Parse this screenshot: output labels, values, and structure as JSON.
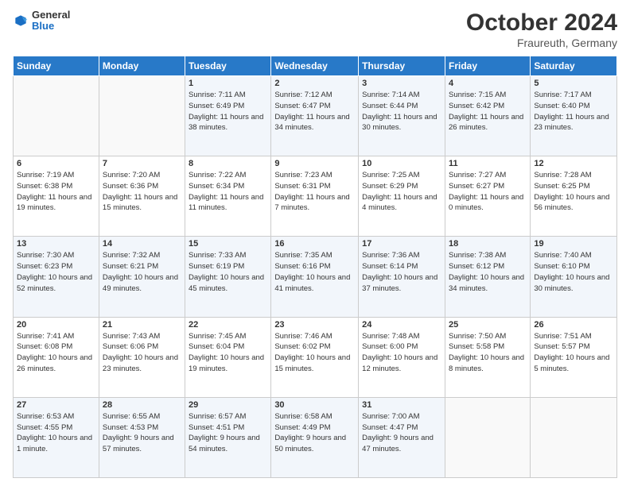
{
  "header": {
    "logo": {
      "line1": "General",
      "line2": "Blue"
    },
    "title": "October 2024",
    "subtitle": "Fraureuth, Germany"
  },
  "calendar": {
    "weekdays": [
      "Sunday",
      "Monday",
      "Tuesday",
      "Wednesday",
      "Thursday",
      "Friday",
      "Saturday"
    ],
    "weeks": [
      [
        {
          "day": "",
          "sunrise": "",
          "sunset": "",
          "daylight": ""
        },
        {
          "day": "",
          "sunrise": "",
          "sunset": "",
          "daylight": ""
        },
        {
          "day": "1",
          "sunrise": "Sunrise: 7:11 AM",
          "sunset": "Sunset: 6:49 PM",
          "daylight": "Daylight: 11 hours and 38 minutes."
        },
        {
          "day": "2",
          "sunrise": "Sunrise: 7:12 AM",
          "sunset": "Sunset: 6:47 PM",
          "daylight": "Daylight: 11 hours and 34 minutes."
        },
        {
          "day": "3",
          "sunrise": "Sunrise: 7:14 AM",
          "sunset": "Sunset: 6:44 PM",
          "daylight": "Daylight: 11 hours and 30 minutes."
        },
        {
          "day": "4",
          "sunrise": "Sunrise: 7:15 AM",
          "sunset": "Sunset: 6:42 PM",
          "daylight": "Daylight: 11 hours and 26 minutes."
        },
        {
          "day": "5",
          "sunrise": "Sunrise: 7:17 AM",
          "sunset": "Sunset: 6:40 PM",
          "daylight": "Daylight: 11 hours and 23 minutes."
        }
      ],
      [
        {
          "day": "6",
          "sunrise": "Sunrise: 7:19 AM",
          "sunset": "Sunset: 6:38 PM",
          "daylight": "Daylight: 11 hours and 19 minutes."
        },
        {
          "day": "7",
          "sunrise": "Sunrise: 7:20 AM",
          "sunset": "Sunset: 6:36 PM",
          "daylight": "Daylight: 11 hours and 15 minutes."
        },
        {
          "day": "8",
          "sunrise": "Sunrise: 7:22 AM",
          "sunset": "Sunset: 6:34 PM",
          "daylight": "Daylight: 11 hours and 11 minutes."
        },
        {
          "day": "9",
          "sunrise": "Sunrise: 7:23 AM",
          "sunset": "Sunset: 6:31 PM",
          "daylight": "Daylight: 11 hours and 7 minutes."
        },
        {
          "day": "10",
          "sunrise": "Sunrise: 7:25 AM",
          "sunset": "Sunset: 6:29 PM",
          "daylight": "Daylight: 11 hours and 4 minutes."
        },
        {
          "day": "11",
          "sunrise": "Sunrise: 7:27 AM",
          "sunset": "Sunset: 6:27 PM",
          "daylight": "Daylight: 11 hours and 0 minutes."
        },
        {
          "day": "12",
          "sunrise": "Sunrise: 7:28 AM",
          "sunset": "Sunset: 6:25 PM",
          "daylight": "Daylight: 10 hours and 56 minutes."
        }
      ],
      [
        {
          "day": "13",
          "sunrise": "Sunrise: 7:30 AM",
          "sunset": "Sunset: 6:23 PM",
          "daylight": "Daylight: 10 hours and 52 minutes."
        },
        {
          "day": "14",
          "sunrise": "Sunrise: 7:32 AM",
          "sunset": "Sunset: 6:21 PM",
          "daylight": "Daylight: 10 hours and 49 minutes."
        },
        {
          "day": "15",
          "sunrise": "Sunrise: 7:33 AM",
          "sunset": "Sunset: 6:19 PM",
          "daylight": "Daylight: 10 hours and 45 minutes."
        },
        {
          "day": "16",
          "sunrise": "Sunrise: 7:35 AM",
          "sunset": "Sunset: 6:16 PM",
          "daylight": "Daylight: 10 hours and 41 minutes."
        },
        {
          "day": "17",
          "sunrise": "Sunrise: 7:36 AM",
          "sunset": "Sunset: 6:14 PM",
          "daylight": "Daylight: 10 hours and 37 minutes."
        },
        {
          "day": "18",
          "sunrise": "Sunrise: 7:38 AM",
          "sunset": "Sunset: 6:12 PM",
          "daylight": "Daylight: 10 hours and 34 minutes."
        },
        {
          "day": "19",
          "sunrise": "Sunrise: 7:40 AM",
          "sunset": "Sunset: 6:10 PM",
          "daylight": "Daylight: 10 hours and 30 minutes."
        }
      ],
      [
        {
          "day": "20",
          "sunrise": "Sunrise: 7:41 AM",
          "sunset": "Sunset: 6:08 PM",
          "daylight": "Daylight: 10 hours and 26 minutes."
        },
        {
          "day": "21",
          "sunrise": "Sunrise: 7:43 AM",
          "sunset": "Sunset: 6:06 PM",
          "daylight": "Daylight: 10 hours and 23 minutes."
        },
        {
          "day": "22",
          "sunrise": "Sunrise: 7:45 AM",
          "sunset": "Sunset: 6:04 PM",
          "daylight": "Daylight: 10 hours and 19 minutes."
        },
        {
          "day": "23",
          "sunrise": "Sunrise: 7:46 AM",
          "sunset": "Sunset: 6:02 PM",
          "daylight": "Daylight: 10 hours and 15 minutes."
        },
        {
          "day": "24",
          "sunrise": "Sunrise: 7:48 AM",
          "sunset": "Sunset: 6:00 PM",
          "daylight": "Daylight: 10 hours and 12 minutes."
        },
        {
          "day": "25",
          "sunrise": "Sunrise: 7:50 AM",
          "sunset": "Sunset: 5:58 PM",
          "daylight": "Daylight: 10 hours and 8 minutes."
        },
        {
          "day": "26",
          "sunrise": "Sunrise: 7:51 AM",
          "sunset": "Sunset: 5:57 PM",
          "daylight": "Daylight: 10 hours and 5 minutes."
        }
      ],
      [
        {
          "day": "27",
          "sunrise": "Sunrise: 6:53 AM",
          "sunset": "Sunset: 4:55 PM",
          "daylight": "Daylight: 10 hours and 1 minute."
        },
        {
          "day": "28",
          "sunrise": "Sunrise: 6:55 AM",
          "sunset": "Sunset: 4:53 PM",
          "daylight": "Daylight: 9 hours and 57 minutes."
        },
        {
          "day": "29",
          "sunrise": "Sunrise: 6:57 AM",
          "sunset": "Sunset: 4:51 PM",
          "daylight": "Daylight: 9 hours and 54 minutes."
        },
        {
          "day": "30",
          "sunrise": "Sunrise: 6:58 AM",
          "sunset": "Sunset: 4:49 PM",
          "daylight": "Daylight: 9 hours and 50 minutes."
        },
        {
          "day": "31",
          "sunrise": "Sunrise: 7:00 AM",
          "sunset": "Sunset: 4:47 PM",
          "daylight": "Daylight: 9 hours and 47 minutes."
        },
        {
          "day": "",
          "sunrise": "",
          "sunset": "",
          "daylight": ""
        },
        {
          "day": "",
          "sunrise": "",
          "sunset": "",
          "daylight": ""
        }
      ]
    ]
  }
}
